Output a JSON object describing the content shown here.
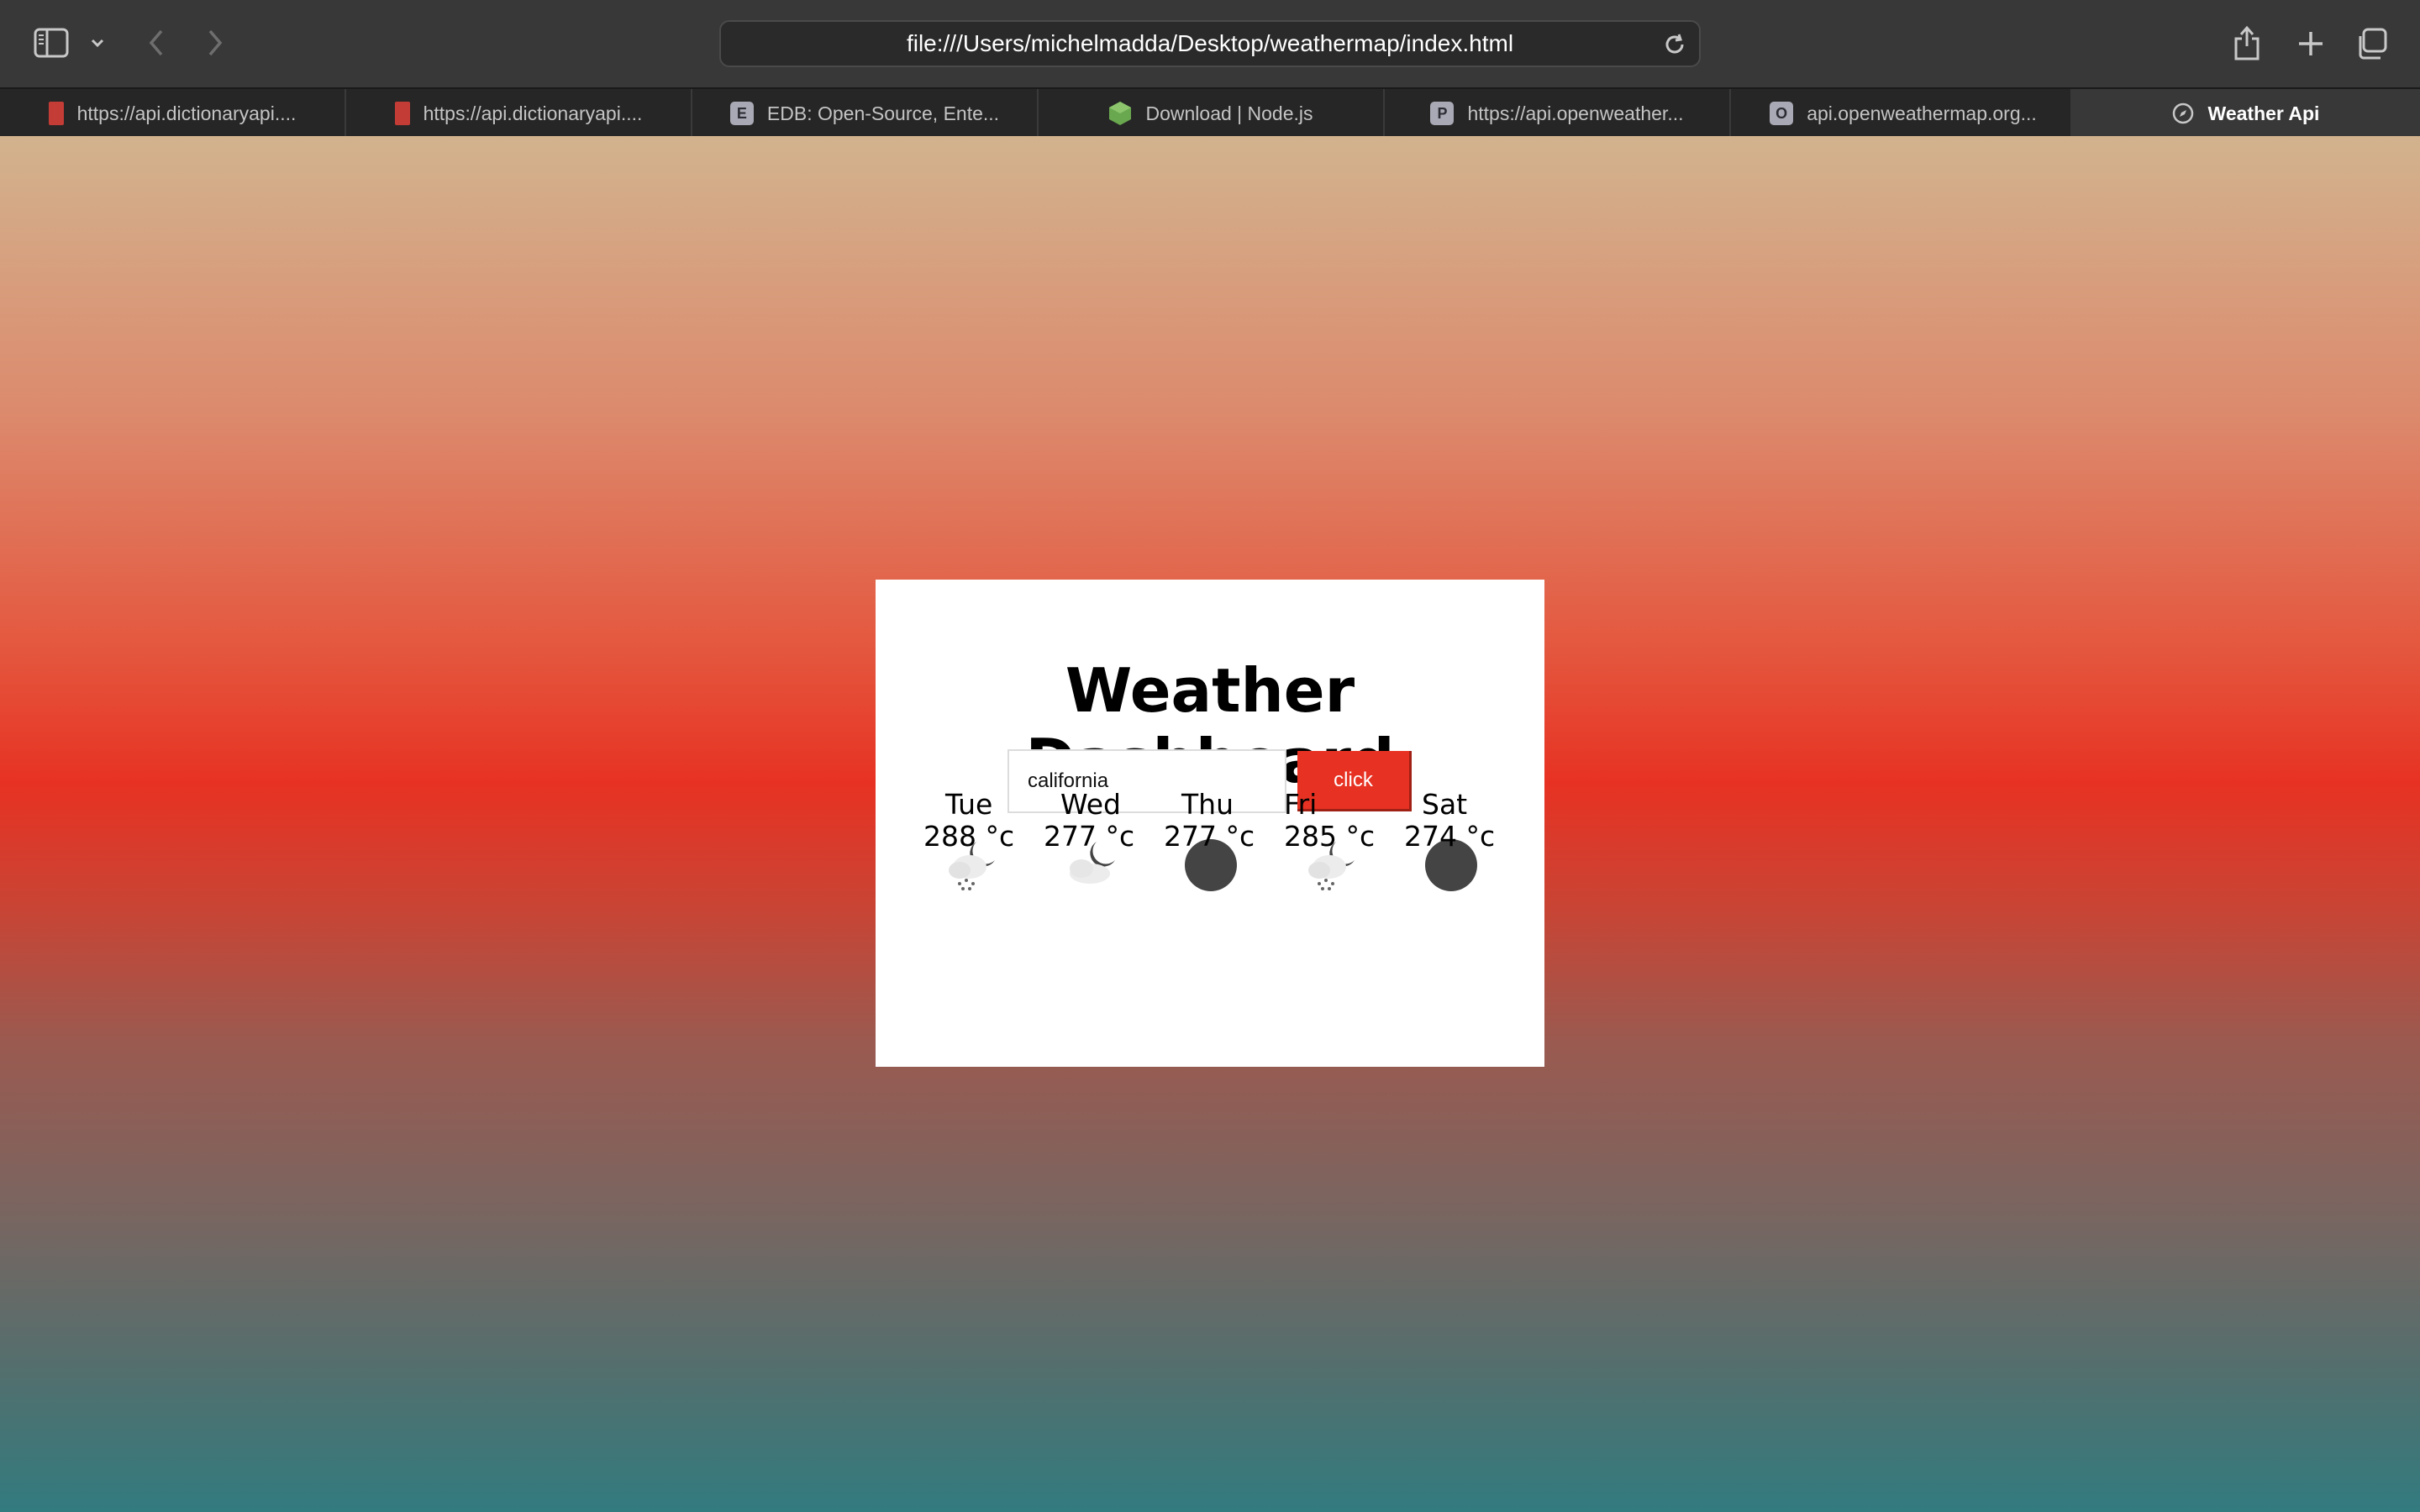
{
  "browser": {
    "url": "file:///Users/michelmadda/Desktop/weathermap/index.html",
    "tabs": [
      {
        "label": "https://api.dictionaryapi....",
        "favicon": "book-icon"
      },
      {
        "label": "https://api.dictionaryapi....",
        "favicon": "book-icon"
      },
      {
        "label": "EDB: Open-Source, Ente...",
        "favicon": "letter-e-icon",
        "favicon_letter": "E"
      },
      {
        "label": "Download | Node.js",
        "favicon": "nodejs-icon"
      },
      {
        "label": "https://api.openweather...",
        "favicon": "letter-p-icon",
        "favicon_letter": "P"
      },
      {
        "label": "api.openweathermap.org...",
        "favicon": "letter-o-icon",
        "favicon_letter": "O"
      },
      {
        "label": "Weather Api",
        "favicon": "compass-icon",
        "active": true
      }
    ]
  },
  "dashboard": {
    "title": "Weather Dashboard",
    "search_value": "california",
    "button_label": "click",
    "accent_color": "#e73223"
  },
  "forecast": [
    {
      "day": "Tue",
      "temp": "288 °c",
      "icon": "snow-night-icon"
    },
    {
      "day": "Wed",
      "temp": "277 °c",
      "icon": "cloudy-night-icon"
    },
    {
      "day": "Thu",
      "temp": "277 °c",
      "icon": "clear-night-icon"
    },
    {
      "day": "Fri",
      "temp": "285 °c",
      "icon": "snow-night-icon"
    },
    {
      "day": "Sat",
      "temp": "274 °c",
      "icon": "clear-night-icon"
    }
  ]
}
